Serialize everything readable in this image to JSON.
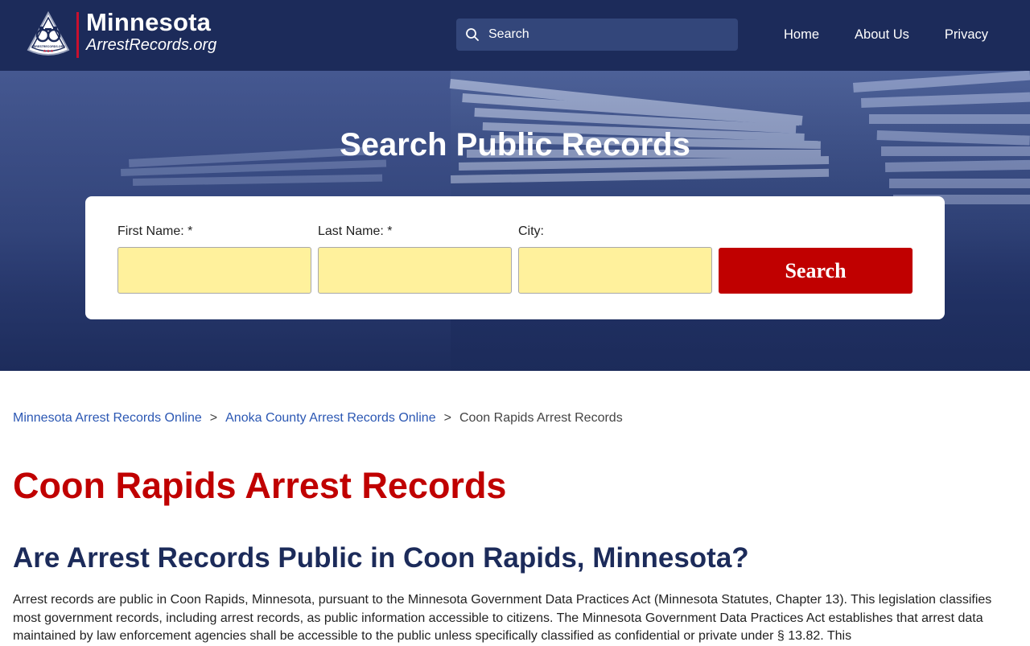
{
  "header": {
    "logo": {
      "badge_text": "ARRESTRECORDS.ORG",
      "title": "Minnesota",
      "subtitle": "ArrestRecords.org"
    },
    "search": {
      "placeholder": "Search",
      "icon": "search-icon"
    },
    "nav": [
      {
        "label": "Home"
      },
      {
        "label": "About Us"
      },
      {
        "label": "Privacy"
      }
    ],
    "colors": {
      "background": "#1c2b5a",
      "accent": "#c8102e"
    }
  },
  "hero": {
    "title": "Search Public Records",
    "form": {
      "fields": [
        {
          "label": "First Name: *",
          "value": ""
        },
        {
          "label": "Last Name: *",
          "value": ""
        },
        {
          "label": "City:",
          "value": ""
        }
      ],
      "submit_label": "Search",
      "colors": {
        "input_bg": "#fff19c",
        "button_bg": "#c00000"
      }
    }
  },
  "breadcrumb": {
    "items": [
      {
        "label": "Minnesota Arrest Records Online"
      },
      {
        "label": "Anoka County Arrest Records Online"
      }
    ],
    "separator": ">",
    "current": "Coon Rapids Arrest Records"
  },
  "main": {
    "title": "Coon Rapids Arrest Records",
    "heading": "Are Arrest Records Public in Coon Rapids, Minnesota?",
    "paragraph": "Arrest records are public in Coon Rapids, Minnesota, pursuant to the Minnesota Government Data Practices Act (Minnesota Statutes, Chapter 13). This legislation classifies most government records, including arrest records, as public information accessible to citizens. The Minnesota Government Data Practices Act establishes that arrest data maintained by law enforcement agencies shall be accessible to the public unless specifically classified as confidential or private under § 13.82. This",
    "colors": {
      "title": "#c00000",
      "heading": "#1c2b5a",
      "link": "#2b57b3"
    }
  }
}
